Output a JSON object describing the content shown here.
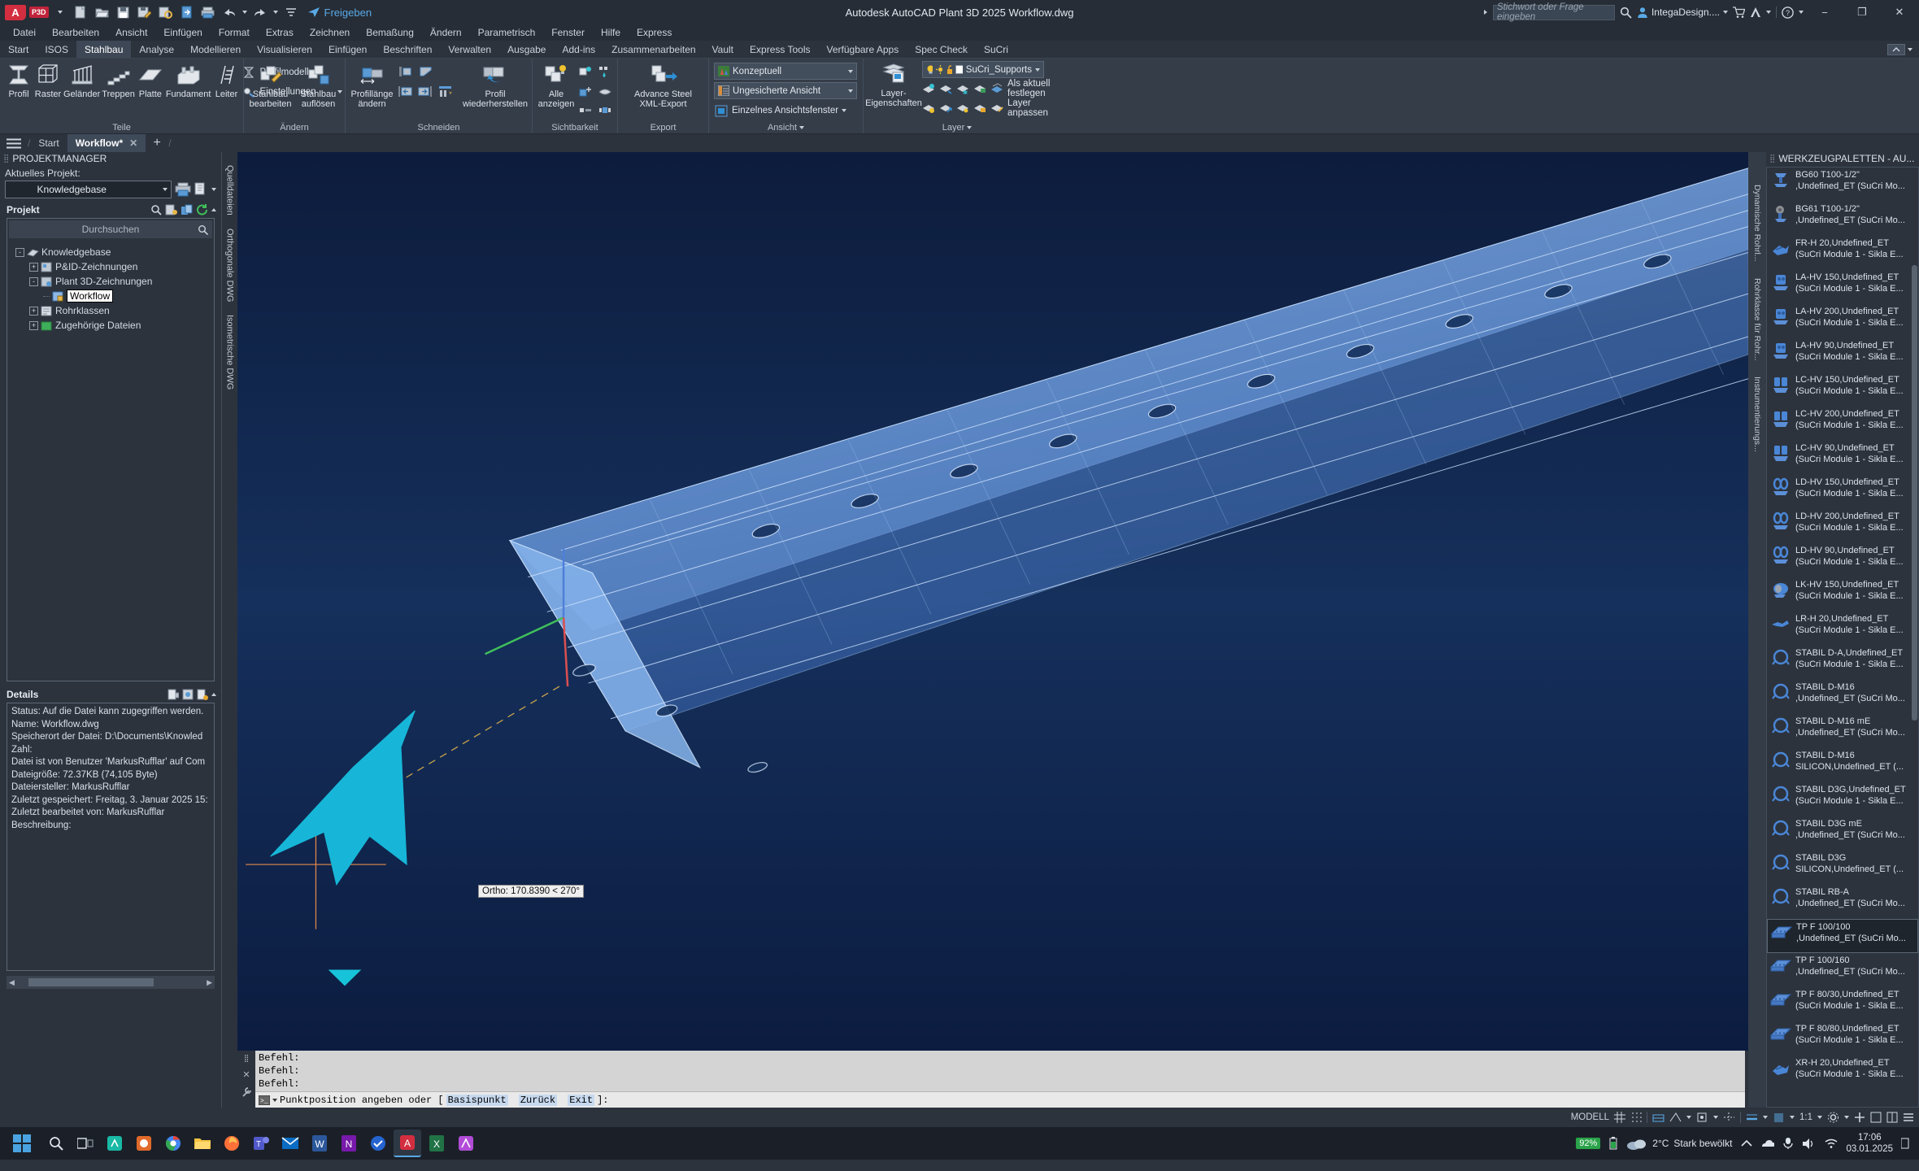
{
  "titlebar": {
    "app_badge": "A",
    "p3d_badge": "P3D",
    "share_label": "Freigeben",
    "app_title": "Autodesk AutoCAD Plant 3D 2025   Workflow.dwg",
    "search_placeholder": "Stichwort oder Frage eingeben",
    "user": "IntegaDesign....",
    "min": "−",
    "max": "❐",
    "close": "✕",
    "quick_access": [
      "new-icon",
      "open-icon",
      "save-icon",
      "save-as-icon",
      "plot-preview-icon",
      "publish-icon",
      "print-icon",
      "undo-icon",
      "redo-icon",
      "customize-icon",
      "share-icon"
    ]
  },
  "menubar": {
    "items": [
      "Datei",
      "Bearbeiten",
      "Ansicht",
      "Einfügen",
      "Format",
      "Extras",
      "Zeichnen",
      "Bemaßung",
      "Ändern",
      "Parametrisch",
      "Fenster",
      "Hilfe",
      "Express"
    ]
  },
  "ribbon_tabs": {
    "items": [
      "Start",
      "ISOS",
      "Stahlbau",
      "Analyse",
      "Modellieren",
      "Visualisieren",
      "Einfügen",
      "Beschriften",
      "Verwalten",
      "Ausgabe",
      "Add-ins",
      "Zusammenarbeiten",
      "Vault",
      "Express Tools",
      "Verfügbare Apps",
      "Spec Check",
      "SuCri"
    ],
    "active": "Stahlbau"
  },
  "ribbon_panels": [
    {
      "title": "Teile",
      "buttons": [
        {
          "label": "Profil",
          "icon": "beam-profile-icon"
        },
        {
          "label": "Raster",
          "icon": "grid-frame-icon"
        },
        {
          "label": "Geländer",
          "icon": "railing-icon"
        },
        {
          "label": "Treppen",
          "icon": "stairs-icon"
        },
        {
          "label": "Platte",
          "icon": "plate-icon"
        },
        {
          "label": "Fundament",
          "icon": "foundation-icon"
        },
        {
          "label": "Leiter",
          "icon": "ladder-icon"
        }
      ],
      "small_items": [
        {
          "label": "Profilmodell",
          "icon": "profile-model-icon",
          "dropdown": true
        },
        {
          "label": "Einstellungen",
          "icon": "settings-icon",
          "dropdown": true
        }
      ]
    },
    {
      "title": "Ändern",
      "buttons": [
        {
          "label": "Stahlbau bearbeiten",
          "icon": "edit-steel-icon"
        },
        {
          "label": "Stahlbau auflösen",
          "icon": "explode-steel-icon"
        }
      ],
      "small_items": []
    },
    {
      "title": "Schneiden",
      "buttons": [
        {
          "label": "Profillänge ändern",
          "icon": "change-length-icon"
        },
        {
          "label": "Profil wiederherstellen",
          "icon": "restore-profile-icon"
        }
      ],
      "small_items": [
        {
          "label": "",
          "icon": "cut-start-icon"
        },
        {
          "label": "",
          "icon": "cut-angle-icon"
        },
        {
          "label": "",
          "icon": "shorten-left-icon"
        },
        {
          "label": "",
          "icon": "shorten-right-icon"
        },
        {
          "label": "",
          "icon": "trim-multi-icon"
        }
      ]
    },
    {
      "title": "Sichtbarkeit",
      "buttons": [
        {
          "label": "Alle anzeigen",
          "icon": "show-all-icon"
        }
      ],
      "small_items": [
        {
          "label": "",
          "icon": "isolate-icon"
        },
        {
          "label": "",
          "icon": "hide-drop-icon"
        },
        {
          "label": "",
          "icon": "add-object-icon"
        },
        {
          "label": "",
          "icon": "hide-object-icon"
        },
        {
          "label": "",
          "icon": "half-view-icon"
        },
        {
          "label": "",
          "icon": "full-view-icon"
        }
      ]
    },
    {
      "title": "Export",
      "buttons": [
        {
          "label": "Advance Steel XML-Export",
          "icon": "xml-export-icon"
        }
      ],
      "small_items": []
    },
    {
      "title": "Ansicht",
      "combos": [
        {
          "value": "Konzeptuell",
          "icon": "visual-style-icon"
        },
        {
          "value": "Ungesicherte Ansicht",
          "icon": "view-icon"
        }
      ],
      "small_items": [
        {
          "label": "Einzelnes Ansichtsfenster",
          "icon": "viewport-icon",
          "dropdown": true
        }
      ]
    },
    {
      "title": "Layer",
      "buttons": [
        {
          "label": "Layer-Eigenschaften",
          "icon": "layer-properties-icon"
        }
      ],
      "layer_combo": {
        "value": "SuCri_Supports",
        "icons": [
          "lightbulb-icon",
          "sun-icon",
          "unlock-icon",
          "color-swatch-icon"
        ]
      },
      "row1": {
        "label": "Als aktuell festlegen",
        "icons": [
          "layer-isolate-icon",
          "layer-unisolate-icon",
          "layer-freeze-icon",
          "layer-lock-icon",
          "layer-set-current-icon"
        ]
      },
      "row2": {
        "label": "Layer anpassen",
        "icons": [
          "layer-off-icon",
          "layer-match-icon",
          "layer-thaw-icon",
          "layer-unlock-icon",
          "layer-merge-icon"
        ]
      }
    }
  ],
  "file_tabs": {
    "items": [
      {
        "label": "Start",
        "active": false,
        "closable": false
      },
      {
        "label": "Workflow*",
        "active": true,
        "closable": true
      }
    ],
    "add_label": "+"
  },
  "project_manager": {
    "title": "PROJEKTMANAGER",
    "current_project_label": "Aktuelles Projekt:",
    "current_project_value": "Knowledgebase",
    "section_title": "Projekt",
    "search_placeholder": "Durchsuchen",
    "tree": [
      {
        "label": "Knowledgebase",
        "level": 0,
        "expander": "-",
        "icon": "project-icon",
        "selected": false
      },
      {
        "label": "P&ID-Zeichnungen",
        "level": 1,
        "expander": "+",
        "icon": "pid-folder-icon",
        "selected": false
      },
      {
        "label": "Plant 3D-Zeichnungen",
        "level": 1,
        "expander": "-",
        "icon": "plant3d-folder-icon",
        "selected": false
      },
      {
        "label": "Workflow",
        "level": 2,
        "expander": "",
        "icon": "dwg-locked-icon",
        "selected": true
      },
      {
        "label": "Rohrklassen",
        "level": 1,
        "expander": "+",
        "icon": "spec-icon",
        "selected": false
      },
      {
        "label": "Zugehörige Dateien",
        "level": 1,
        "expander": "+",
        "icon": "related-files-icon",
        "selected": false
      }
    ],
    "details_title": "Details",
    "details_lines": [
      "Status: Auf die Datei kann zugegriffen werden.",
      "Name: Workflow.dwg",
      "Speicherort der Datei: D:\\Documents\\Knowled",
      "Zahl:",
      "Datei ist von Benutzer 'MarkusRufflar' auf Com",
      "Dateigröße: 72.37KB (74,105 Byte)",
      "Dateiersteller:  MarkusRufflar",
      "Zuletzt gespeichert: Freitag, 3. Januar 2025 15:",
      "Zuletzt bearbeitet von: MarkusRufflar",
      "Beschreibung:"
    ]
  },
  "left_vtabs": [
    "Quelldateien",
    "Orthogonale DWG",
    "Isometrische DWG"
  ],
  "right_vtabs": [
    "Dynamische Rohrl...",
    "Rohrklasse für Rohr...",
    "Instrumentierungs..."
  ],
  "canvas": {
    "ortho_tooltip": "Ortho: 170.8390 < 270°",
    "model_color": "#7fb3ff",
    "background_color": "#102347",
    "cursor_color": "#00b7d4"
  },
  "command_line": {
    "history": [
      "Befehl:",
      "Befehl:",
      "Befehl:"
    ],
    "prompt_prefix": "Punktposition angeben oder [",
    "keywords": [
      "Basispunkt",
      "Zurück",
      "Exit"
    ],
    "prompt_suffix": "]:"
  },
  "tool_palette": {
    "title": "WERKZEUGPALETTEN - AU...",
    "items": [
      {
        "name": "BG60 T100-1/2\"",
        "sub": ",Undefined_ET (SuCri Mo...",
        "icon": "support-clamp-icon",
        "selected": false,
        "partial": true
      },
      {
        "name": "BG61 T100-1/2\"",
        "sub": ",Undefined_ET (SuCri Mo...",
        "icon": "roller-support-icon",
        "selected": false
      },
      {
        "name": "FR-H 20,Undefined_ET",
        "sub": "(SuCri Module 1 - Sikla E...",
        "icon": "bracket-icon",
        "selected": false
      },
      {
        "name": "LA-HV 150,Undefined_ET",
        "sub": "(SuCri Module 1 - Sikla E...",
        "icon": "la-support-icon",
        "selected": false
      },
      {
        "name": "LA-HV 200,Undefined_ET",
        "sub": "(SuCri Module 1 - Sikla E...",
        "icon": "la-support-icon",
        "selected": false
      },
      {
        "name": "LA-HV 90,Undefined_ET",
        "sub": "(SuCri Module 1 - Sikla E...",
        "icon": "la-support-icon",
        "selected": false
      },
      {
        "name": "LC-HV 150,Undefined_ET",
        "sub": "(SuCri Module 1 - Sikla E...",
        "icon": "lc-support-icon",
        "selected": false
      },
      {
        "name": "LC-HV 200,Undefined_ET",
        "sub": "(SuCri Module 1 - Sikla E...",
        "icon": "lc-support-icon",
        "selected": false
      },
      {
        "name": "LC-HV 90,Undefined_ET",
        "sub": "(SuCri Module 1 - Sikla E...",
        "icon": "lc-support-icon",
        "selected": false
      },
      {
        "name": "LD-HV 150,Undefined_ET",
        "sub": "(SuCri Module 1 - Sikla E...",
        "icon": "ld-support-icon",
        "selected": false
      },
      {
        "name": "LD-HV 200,Undefined_ET",
        "sub": "(SuCri Module 1 - Sikla E...",
        "icon": "ld-support-icon",
        "selected": false
      },
      {
        "name": "LD-HV 90,Undefined_ET",
        "sub": "(SuCri Module 1 - Sikla E...",
        "icon": "ld-support-icon",
        "selected": false
      },
      {
        "name": "LK-HV 150,Undefined_ET",
        "sub": "(SuCri Module 1 - Sikla E...",
        "icon": "lk-clamp-icon",
        "selected": false
      },
      {
        "name": "LR-H 20,Undefined_ET",
        "sub": "(SuCri Module 1 - Sikla E...",
        "icon": "lr-bracket-icon",
        "selected": false
      },
      {
        "name": "STABIL D-A,Undefined_ET",
        "sub": "(SuCri Module 1 - Sikla E...",
        "icon": "stabil-ring-icon",
        "selected": false
      },
      {
        "name": "STABIL D-M16",
        "sub": ",Undefined_ET (SuCri Mo...",
        "icon": "stabil-ring-icon",
        "selected": false
      },
      {
        "name": "STABIL D-M16 mE",
        "sub": ",Undefined_ET (SuCri Mo...",
        "icon": "stabil-ring-icon",
        "selected": false
      },
      {
        "name": "STABIL D-M16",
        "sub": "SILICON,Undefined_ET  (...",
        "icon": "stabil-ring-icon",
        "selected": false
      },
      {
        "name": "STABIL D3G,Undefined_ET",
        "sub": "(SuCri Module 1 - Sikla E...",
        "icon": "stabil-ring-icon",
        "selected": false
      },
      {
        "name": "STABIL D3G mE",
        "sub": ",Undefined_ET (SuCri Mo...",
        "icon": "stabil-ring-icon",
        "selected": false
      },
      {
        "name": "STABIL D3G",
        "sub": "SILICON,Undefined_ET  (...",
        "icon": "stabil-ring-icon",
        "selected": false
      },
      {
        "name": "STABIL RB-A",
        "sub": ",Undefined_ET (SuCri Mo...",
        "icon": "stabil-ring-icon",
        "selected": false
      },
      {
        "name": "TP F 100/100",
        "sub": ",Undefined_ET (SuCri Mo...",
        "icon": "channel-profile-icon",
        "selected": true
      },
      {
        "name": "TP F 100/160",
        "sub": ",Undefined_ET (SuCri Mo...",
        "icon": "channel-profile-icon",
        "selected": false
      },
      {
        "name": "TP F 80/30,Undefined_ET",
        "sub": "(SuCri Module 1 - Sikla E...",
        "icon": "channel-profile-icon",
        "selected": false
      },
      {
        "name": "TP F 80/80,Undefined_ET",
        "sub": "(SuCri Module 1 - Sikla E...",
        "icon": "channel-profile-icon",
        "selected": false
      },
      {
        "name": "XR-H 20,Undefined_ET",
        "sub": "(SuCri Module 1 - Sikla E...",
        "icon": "bracket-icon",
        "selected": false
      }
    ]
  },
  "statusbar": {
    "space_label": "MODELL",
    "scale": "1:1",
    "icons_left": [
      "grid-icon",
      "snap-icon",
      "ortho-icon",
      "polar-icon",
      "osnap-icon",
      "otrack-icon",
      "lineweight-icon",
      "transparency-icon",
      "selection-cycling-icon",
      "annotation-icon"
    ],
    "icons_right": [
      "scale-icon",
      "gear-icon",
      "plus-icon",
      "maximize-icon",
      "viewport-icon",
      "layout-icon",
      "customize-icon"
    ]
  },
  "taskbar": {
    "icons": [
      "start-icon",
      "search-icon",
      "taskview-icon",
      "app1-icon",
      "app2-icon",
      "chrome-icon",
      "explorer-icon",
      "firefox-icon",
      "teams-icon",
      "mail-icon",
      "word-icon",
      "onenote-icon",
      "todo-icon",
      "autocad-icon",
      "excel-icon",
      "designer-icon"
    ],
    "battery": "92%",
    "weather_temp": "2°C",
    "weather_desc": "Stark bewölkt",
    "time": "17:06",
    "date": "03.01.2025"
  }
}
